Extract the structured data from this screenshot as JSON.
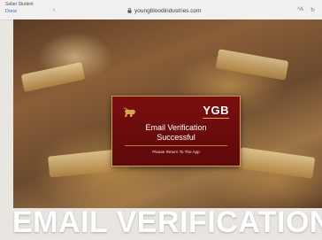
{
  "browser": {
    "status_text": "Safari Student",
    "done_label": "Done",
    "nav_icon": "chevron-left-icon",
    "url": "youngbloodindustries.com",
    "lock_icon": "lock-icon",
    "right_icons": [
      "aa-text-icon",
      "reload-icon"
    ]
  },
  "card": {
    "brand": "YGB",
    "title_line1": "Email Verification",
    "title_line2": "Successful",
    "subtitle": "Please Return To The App",
    "accent_color": "#c99b55",
    "background_color": "#6e0c0d"
  },
  "caption": {
    "text": "EMAIL VERIFICATION"
  }
}
